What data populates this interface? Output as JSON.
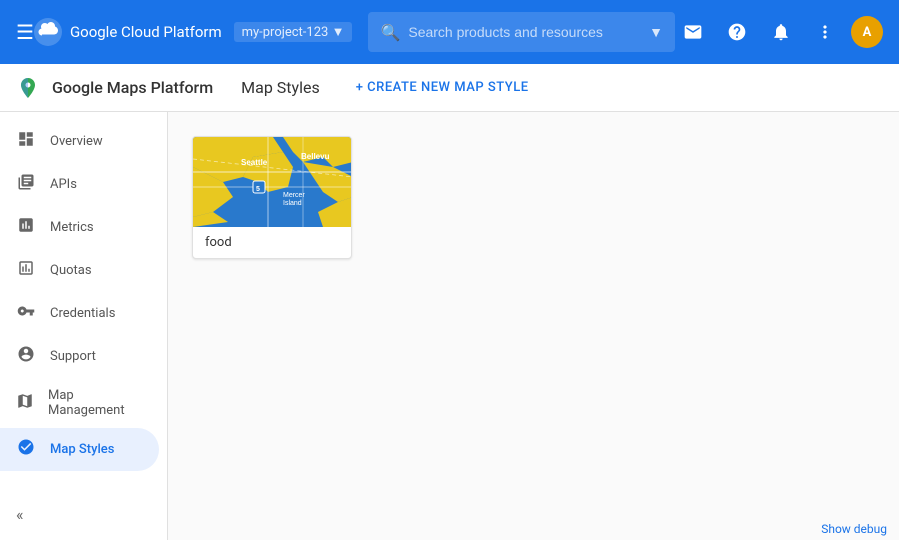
{
  "topbar": {
    "menu_icon": "☰",
    "title": "Google Cloud Platform",
    "project": "my-project-123",
    "search_placeholder": "Search products and resources",
    "email_icon": "✉",
    "help_icon": "?",
    "bell_icon": "🔔",
    "more_icon": "⋮",
    "avatar_label": "A"
  },
  "subheader": {
    "brand": "Google Maps Platform",
    "page_title": "Map Styles",
    "action_label": "+ CREATE NEW MAP STYLE"
  },
  "sidebar": {
    "items": [
      {
        "id": "overview",
        "label": "Overview",
        "icon": "⊞"
      },
      {
        "id": "apis",
        "label": "APIs",
        "icon": "≡"
      },
      {
        "id": "metrics",
        "label": "Metrics",
        "icon": "📊"
      },
      {
        "id": "quotas",
        "label": "Quotas",
        "icon": "⊡"
      },
      {
        "id": "credentials",
        "label": "Credentials",
        "icon": "🔑"
      },
      {
        "id": "support",
        "label": "Support",
        "icon": "👤"
      },
      {
        "id": "map-management",
        "label": "Map Management",
        "icon": "⊞"
      },
      {
        "id": "map-styles",
        "label": "Map Styles",
        "icon": "◎",
        "active": true
      }
    ],
    "collapse_icon": "«"
  },
  "main": {
    "map_card": {
      "label": "food"
    }
  },
  "footer": {
    "debug_label": "Show debug"
  }
}
